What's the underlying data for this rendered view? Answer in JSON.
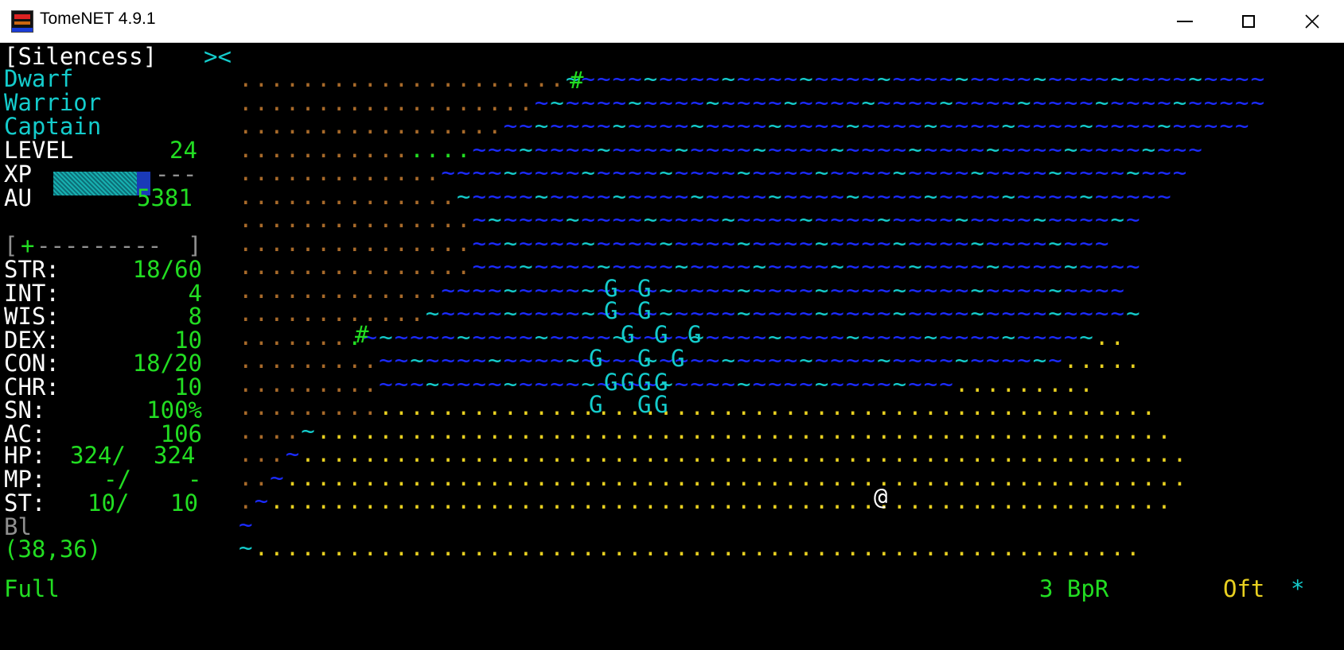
{
  "window": {
    "title": "TomeNET 4.9.1"
  },
  "sidebar": {
    "player": "[Silencess]",
    "party_mark": "><",
    "race": "Dwarf",
    "class": "Warrior",
    "title": "Captain",
    "level_label": "LEVEL",
    "level_value": "24",
    "xp_label": "XP",
    "xp_tail": "---",
    "xp_progress_fraction": 0.82,
    "au_label": "AU",
    "au_value": "5381",
    "equip_bar_left": "[",
    "equip_bar_mark": "+",
    "equip_bar_fill": "---------",
    "equip_bar_right": "]",
    "stats": [
      {
        "label": "STR:",
        "value": "18/60"
      },
      {
        "label": "INT:",
        "value": "4"
      },
      {
        "label": "WIS:",
        "value": "8"
      },
      {
        "label": "DEX:",
        "value": "10"
      },
      {
        "label": "CON:",
        "value": "18/20"
      },
      {
        "label": "CHR:",
        "value": "10"
      },
      {
        "label": "SN:",
        "value": "100%"
      },
      {
        "label": "AC:",
        "value": "106"
      }
    ],
    "hp": {
      "label": "HP:",
      "cur": "324/",
      "max": "324"
    },
    "mp": {
      "label": "MP:",
      "cur": "-/",
      "max": "-"
    },
    "st": {
      "label": "ST:",
      "cur": "10/",
      "max": "10"
    },
    "bl_label": "Bl",
    "coords": "(38,36)"
  },
  "status_bar": {
    "left": "Full",
    "bpr": "3 BpR",
    "oft": "Oft",
    "star": "*"
  },
  "colors": {
    "white": "#ffffff",
    "green": "#22dd22",
    "cyan": "#14cccc",
    "blue": "#1b2bff",
    "yellow": "#e8d020",
    "brown": "#a86a2a",
    "gray": "#909090"
  },
  "map_rows": [
    {
      "o": 21,
      "b": 0,
      "h": 1,
      "w": 44,
      "y": 0,
      "tail": "~"
    },
    {
      "o": 19,
      "b": 0,
      "h": 0,
      "w": 46,
      "y": 0,
      "tail": "~"
    },
    {
      "o": 17,
      "b": 0,
      "h": 0,
      "w": 47,
      "y": 0,
      "tail": "~"
    },
    {
      "o": 11,
      "b": 4,
      "h": 0,
      "w": 47,
      "y": 0,
      "tail": ""
    },
    {
      "o": 13,
      "b": 0,
      "h": 0,
      "w": 48,
      "y": 0,
      "tail": ""
    },
    {
      "o": 14,
      "b": 0,
      "h": 0,
      "w": 45,
      "y": 0,
      "tail": "~"
    },
    {
      "o": 15,
      "b": 0,
      "h": 0,
      "w": 42,
      "y": 0,
      "tail": "~"
    },
    {
      "o": 15,
      "b": 0,
      "h": 0,
      "w": 41,
      "y": 0,
      "tail": ""
    },
    {
      "o": 15,
      "b": 0,
      "h": 0,
      "w": 42,
      "y": 0,
      "tail": "~"
    },
    {
      "o": 13,
      "b": 0,
      "h": 0,
      "w": 44,
      "y": 0,
      "tail": ""
    },
    {
      "o": 12,
      "b": 0,
      "h": 0,
      "w": 46,
      "y": 0,
      "tail": ""
    },
    {
      "o": 7,
      "b": 1,
      "h": 1,
      "w": 47,
      "y": 2,
      "tail": ""
    },
    {
      "o": 9,
      "b": 0,
      "h": 0,
      "w": 44,
      "y": 5,
      "tail": ""
    },
    {
      "o": 9,
      "b": 0,
      "h": 0,
      "w": 37,
      "y": 9,
      "tail": ""
    },
    {
      "o": 9,
      "b": 0,
      "h": 0,
      "w": 0,
      "y": 50,
      "tail": ""
    },
    {
      "o": 4,
      "b": 0,
      "h": 0,
      "w": 1,
      "y": 55,
      "tail": ""
    },
    {
      "o": 3,
      "b": 0,
      "h": 0,
      "w": 1,
      "y": 57,
      "tail": ""
    },
    {
      "o": 2,
      "b": 0,
      "h": 0,
      "w": 1,
      "y": 58,
      "tail": ""
    },
    {
      "o": 1,
      "b": 0,
      "h": 0,
      "w": 1,
      "y": 58,
      "tail": ""
    },
    {
      "o": 0,
      "b": 0,
      "h": 0,
      "w": 1,
      "y": 0,
      "tail": ""
    },
    {
      "o": 0,
      "b": 0,
      "h": 0,
      "w": 1,
      "y": 57,
      "tail": ""
    }
  ],
  "creatures": {
    "ghost_glyph": "G",
    "player_glyph": "@",
    "wall_glyph": "#"
  }
}
